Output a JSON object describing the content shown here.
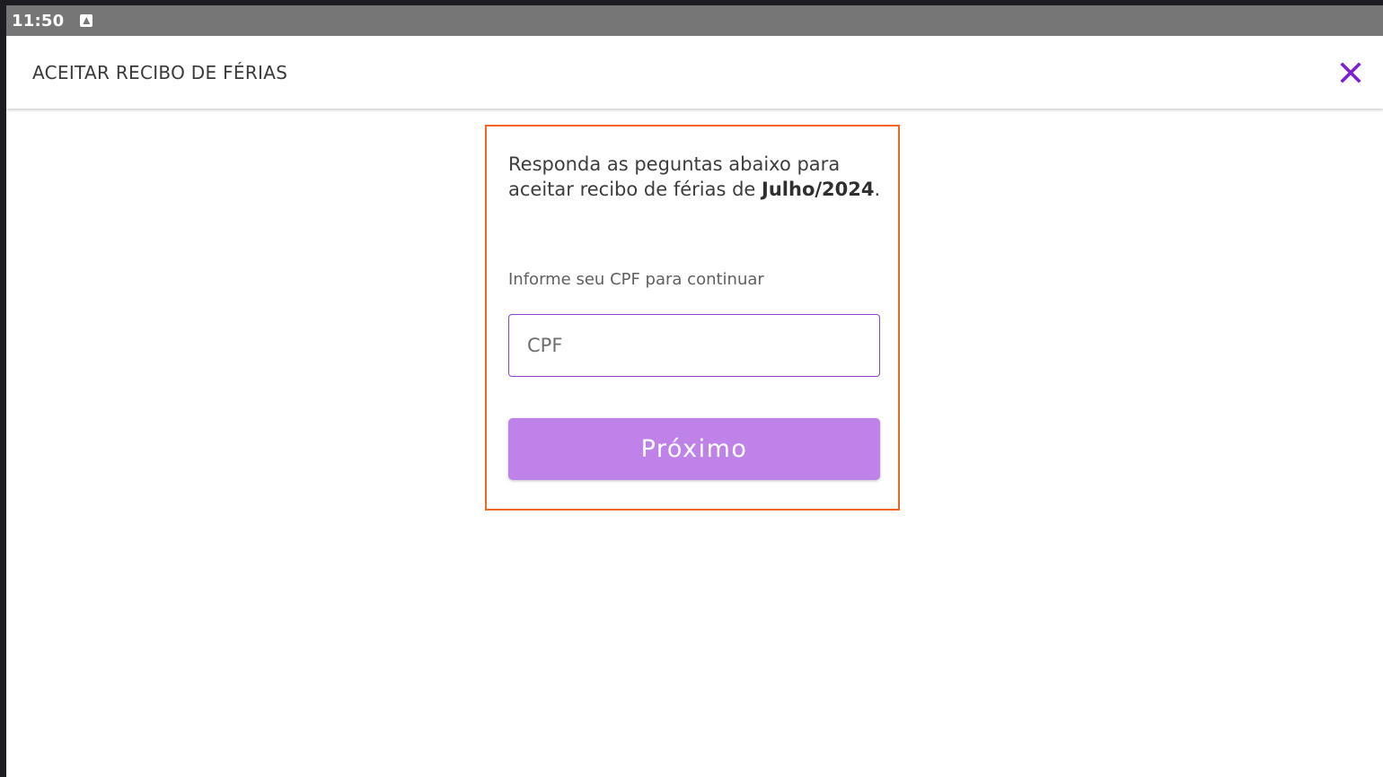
{
  "statusbar": {
    "time": "11:50",
    "notification_icon": "a-notification-icon"
  },
  "appbar": {
    "title": "ACEITAR RECIBO DE FÉRIAS",
    "close_icon": "close-icon",
    "close_color": "#7b1fd1"
  },
  "form": {
    "intro_text": "Responda as peguntas abaixo para aceitar recibo de férias de",
    "period": "Julho/2024",
    "intro_suffix": ".",
    "cpf_label": "Informe seu CPF para continuar",
    "cpf_value": "",
    "cpf_placeholder": "CPF",
    "next_button": "Próximo"
  },
  "colors": {
    "accent": "#8e44d0",
    "button": "#bf82e8",
    "highlight_border": "#f26522"
  }
}
